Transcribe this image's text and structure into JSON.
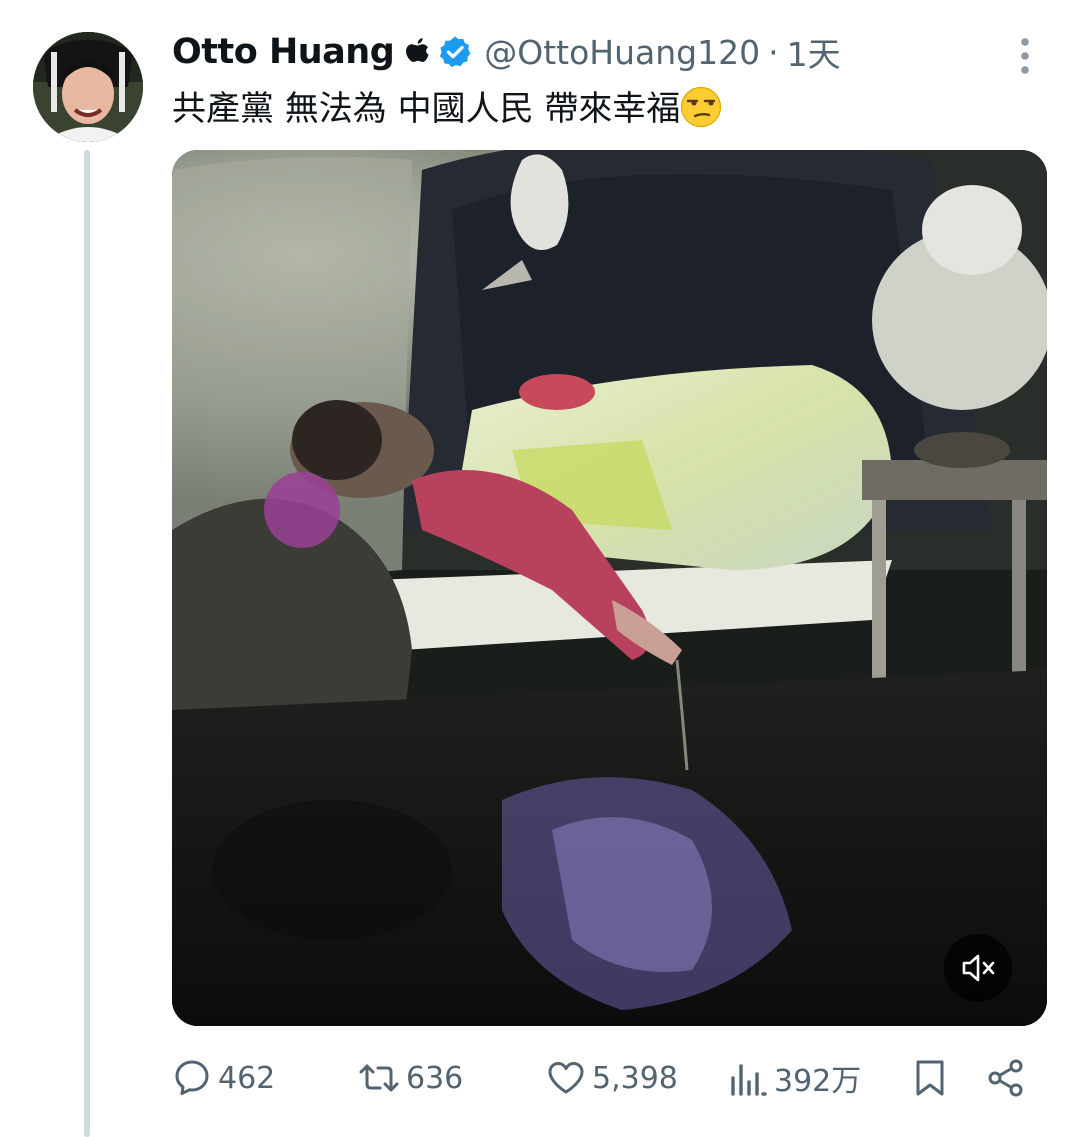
{
  "tweet": {
    "author": {
      "display_name": "Otto Huang",
      "handle": "@OttoHuang120",
      "verified": true,
      "avatar_icon": "user-avatar"
    },
    "time": "1天",
    "separator": "·",
    "text": "共產黨 無法為 中國人民 帶來幸福",
    "emoji": "unamused-face-emoji",
    "media": {
      "type": "video",
      "muted": true,
      "mute_icon": "speaker-muted-icon"
    },
    "stats": {
      "replies": "462",
      "retweets": "636",
      "likes": "5,398",
      "views": "392万"
    }
  },
  "colors": {
    "text": "#0f1419",
    "secondary": "#536471",
    "verified": "#1d9bf0",
    "thread_line": "#cfd9de"
  }
}
